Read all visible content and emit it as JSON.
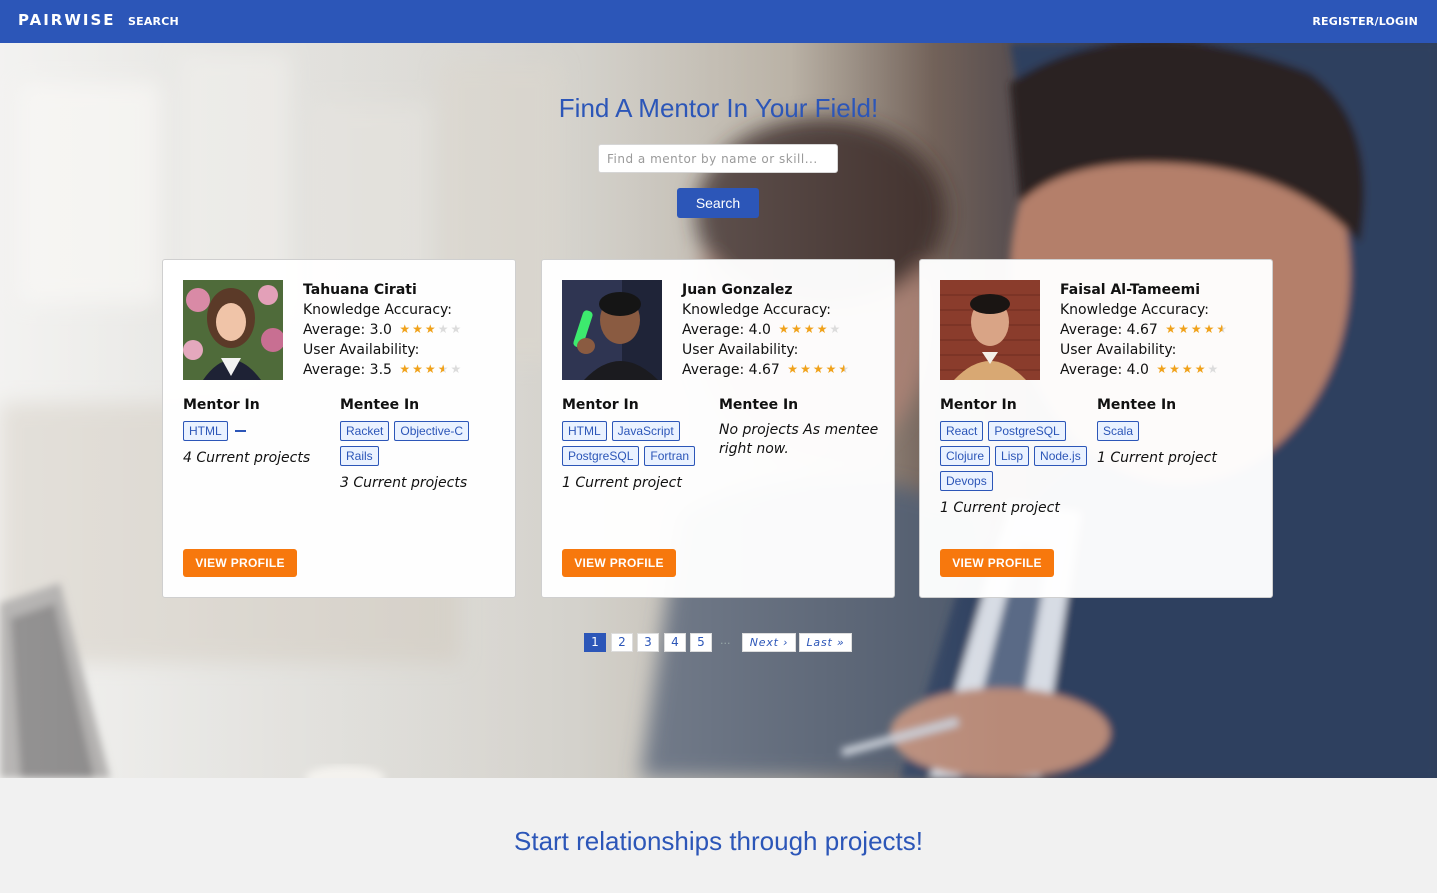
{
  "navbar": {
    "brand": "PAIRWISE",
    "search_link": "SEARCH",
    "register_link": "REGISTER/LOGIN"
  },
  "hero": {
    "title": "Find A Mentor In Your Field!",
    "search_placeholder": "Find a mentor by name or skill...",
    "search_button": "Search"
  },
  "labels": {
    "knowledge_accuracy": "Knowledge Accuracy:",
    "user_availability": "User Availability:",
    "average": "Average:",
    "mentor_in": "Mentor In",
    "mentee_in": "Mentee In",
    "view_profile": "VIEW PROFILE"
  },
  "mentors": [
    {
      "name": "Tahuana Cirati",
      "knowledge_avg": "3.0",
      "knowledge_rating": 3.0,
      "availability_avg": "3.5",
      "availability_rating": 3.5,
      "mentor_in": [
        "HTML"
      ],
      "mentor_projects": "4 Current projects",
      "mentee_in": [
        "Racket",
        "Objective-C",
        "Rails"
      ],
      "mentee_projects": "3 Current projects",
      "mentee_note": ""
    },
    {
      "name": "Juan Gonzalez",
      "knowledge_avg": "4.0",
      "knowledge_rating": 4.0,
      "availability_avg": "4.67",
      "availability_rating": 4.67,
      "mentor_in": [
        "HTML",
        "JavaScript",
        "PostgreSQL",
        "Fortran"
      ],
      "mentor_projects": "1 Current project",
      "mentee_in": [],
      "mentee_projects": "",
      "mentee_note": "No projects As mentee right now."
    },
    {
      "name": "Faisal Al-Tameemi",
      "knowledge_avg": "4.67",
      "knowledge_rating": 4.67,
      "availability_avg": "4.0",
      "availability_rating": 4.0,
      "mentor_in": [
        "React",
        "PostgreSQL",
        "Clojure",
        "Lisp",
        "Node.js",
        "Devops"
      ],
      "mentor_projects": "1 Current project",
      "mentee_in": [
        "Scala"
      ],
      "mentee_projects": "1 Current project",
      "mentee_note": ""
    }
  ],
  "pagination": {
    "pages": [
      "1",
      "2",
      "3",
      "4",
      "5"
    ],
    "active_page": "1",
    "ellipsis": "...",
    "next": "Next ›",
    "last": "Last »"
  },
  "footer": {
    "tagline": "Start relationships through projects!"
  },
  "colors": {
    "primary": "#2c56b8",
    "accent": "#f7780d",
    "star": "#f0a21b"
  },
  "icons": {
    "star": "star-icon",
    "half_star": "half-star-icon",
    "empty_star": "empty-star-icon"
  }
}
